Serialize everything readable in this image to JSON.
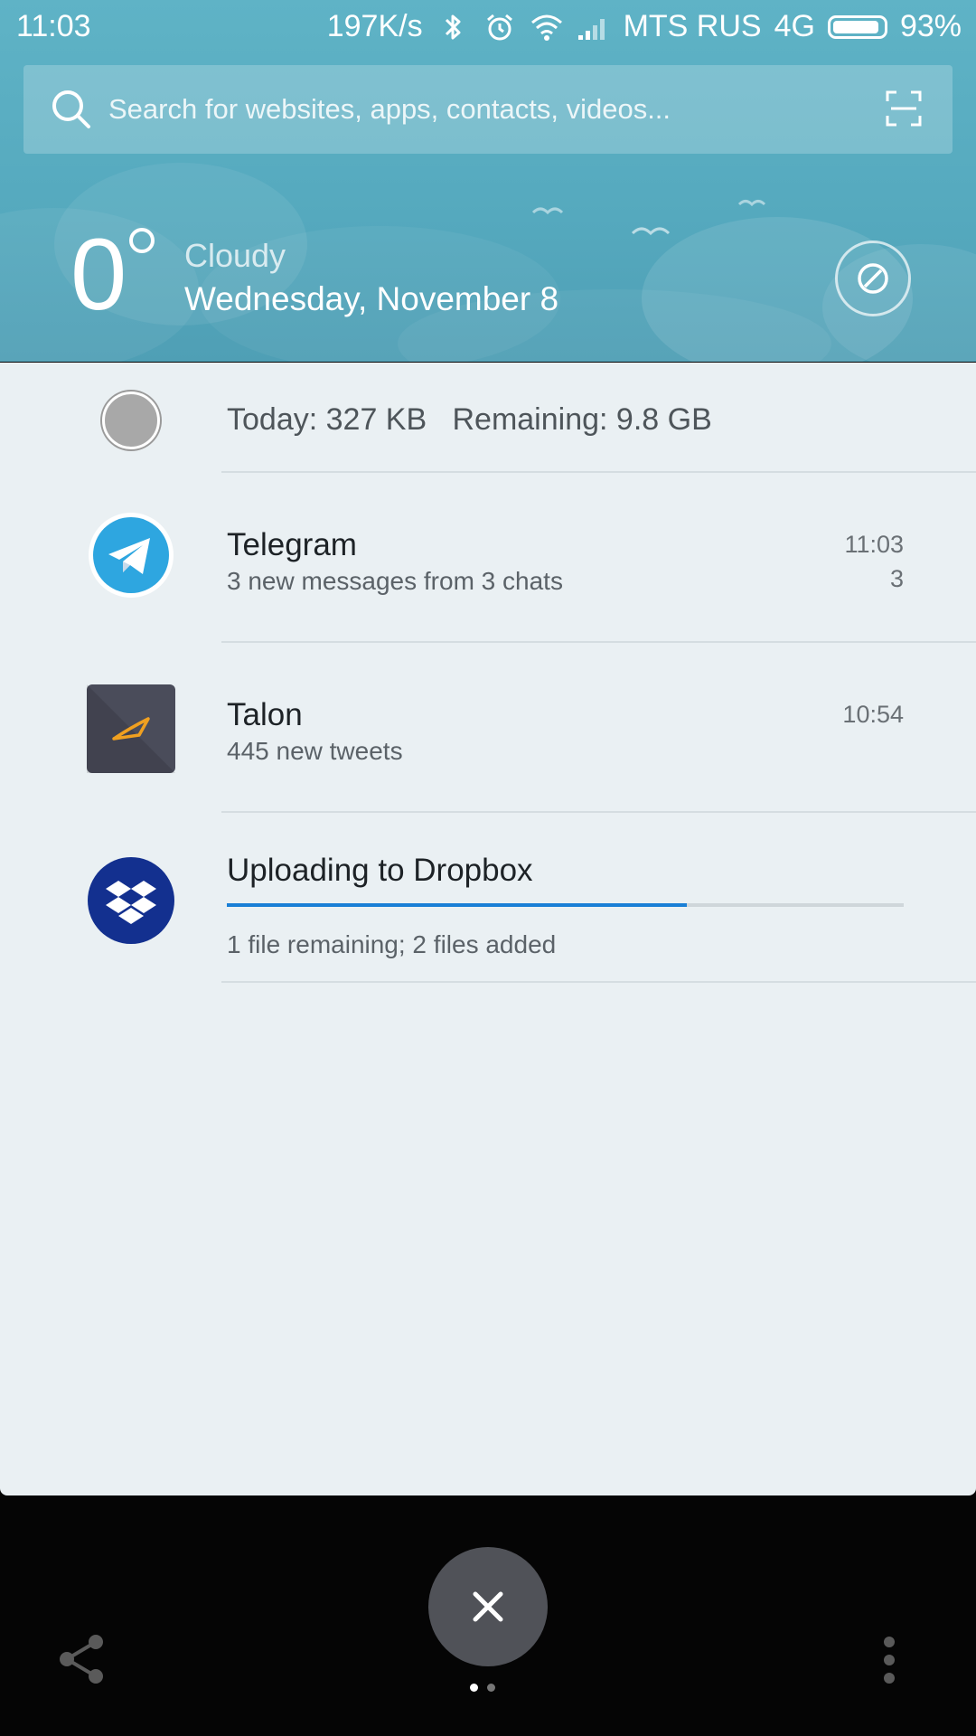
{
  "status_bar": {
    "time": "11:03",
    "speed": "197K/s",
    "carrier": "MTS RUS",
    "network": "4G",
    "battery": "93%",
    "battery_level": 0.93
  },
  "search": {
    "placeholder": "Search for websites, apps, contacts, videos..."
  },
  "weather": {
    "temperature": "0",
    "condition": "Cloudy",
    "date": "Wednesday, November 8"
  },
  "data_usage": {
    "text": "Today: 327 KB   Remaining: 9.8 GB"
  },
  "notifications": [
    {
      "app": "telegram",
      "title": "Telegram",
      "text": "3 new messages from 3 chats",
      "time": "11:03",
      "count": "3"
    },
    {
      "app": "talon",
      "title": "Talon",
      "text": "445 new tweets",
      "time": "10:54"
    },
    {
      "app": "dropbox",
      "title": "Uploading to Dropbox",
      "text": "1 file remaining; 2 files added",
      "progress": 0.68
    }
  ],
  "colors": {
    "header": "#5fb3c6",
    "panel": "#eaf0f3",
    "progress": "#1a7fd6",
    "telegram": "#2ea6e0",
    "dropbox": "#13308f",
    "talon": "#4a4c5a"
  },
  "icons": [
    "search-icon",
    "scan-icon",
    "bluetooth-icon",
    "alarm-icon",
    "wifi-icon",
    "signal-icon",
    "battery-icon",
    "weather-settings-icon",
    "telegram-icon",
    "talon-icon",
    "dropbox-icon",
    "close-icon",
    "share-icon",
    "more-icon"
  ]
}
